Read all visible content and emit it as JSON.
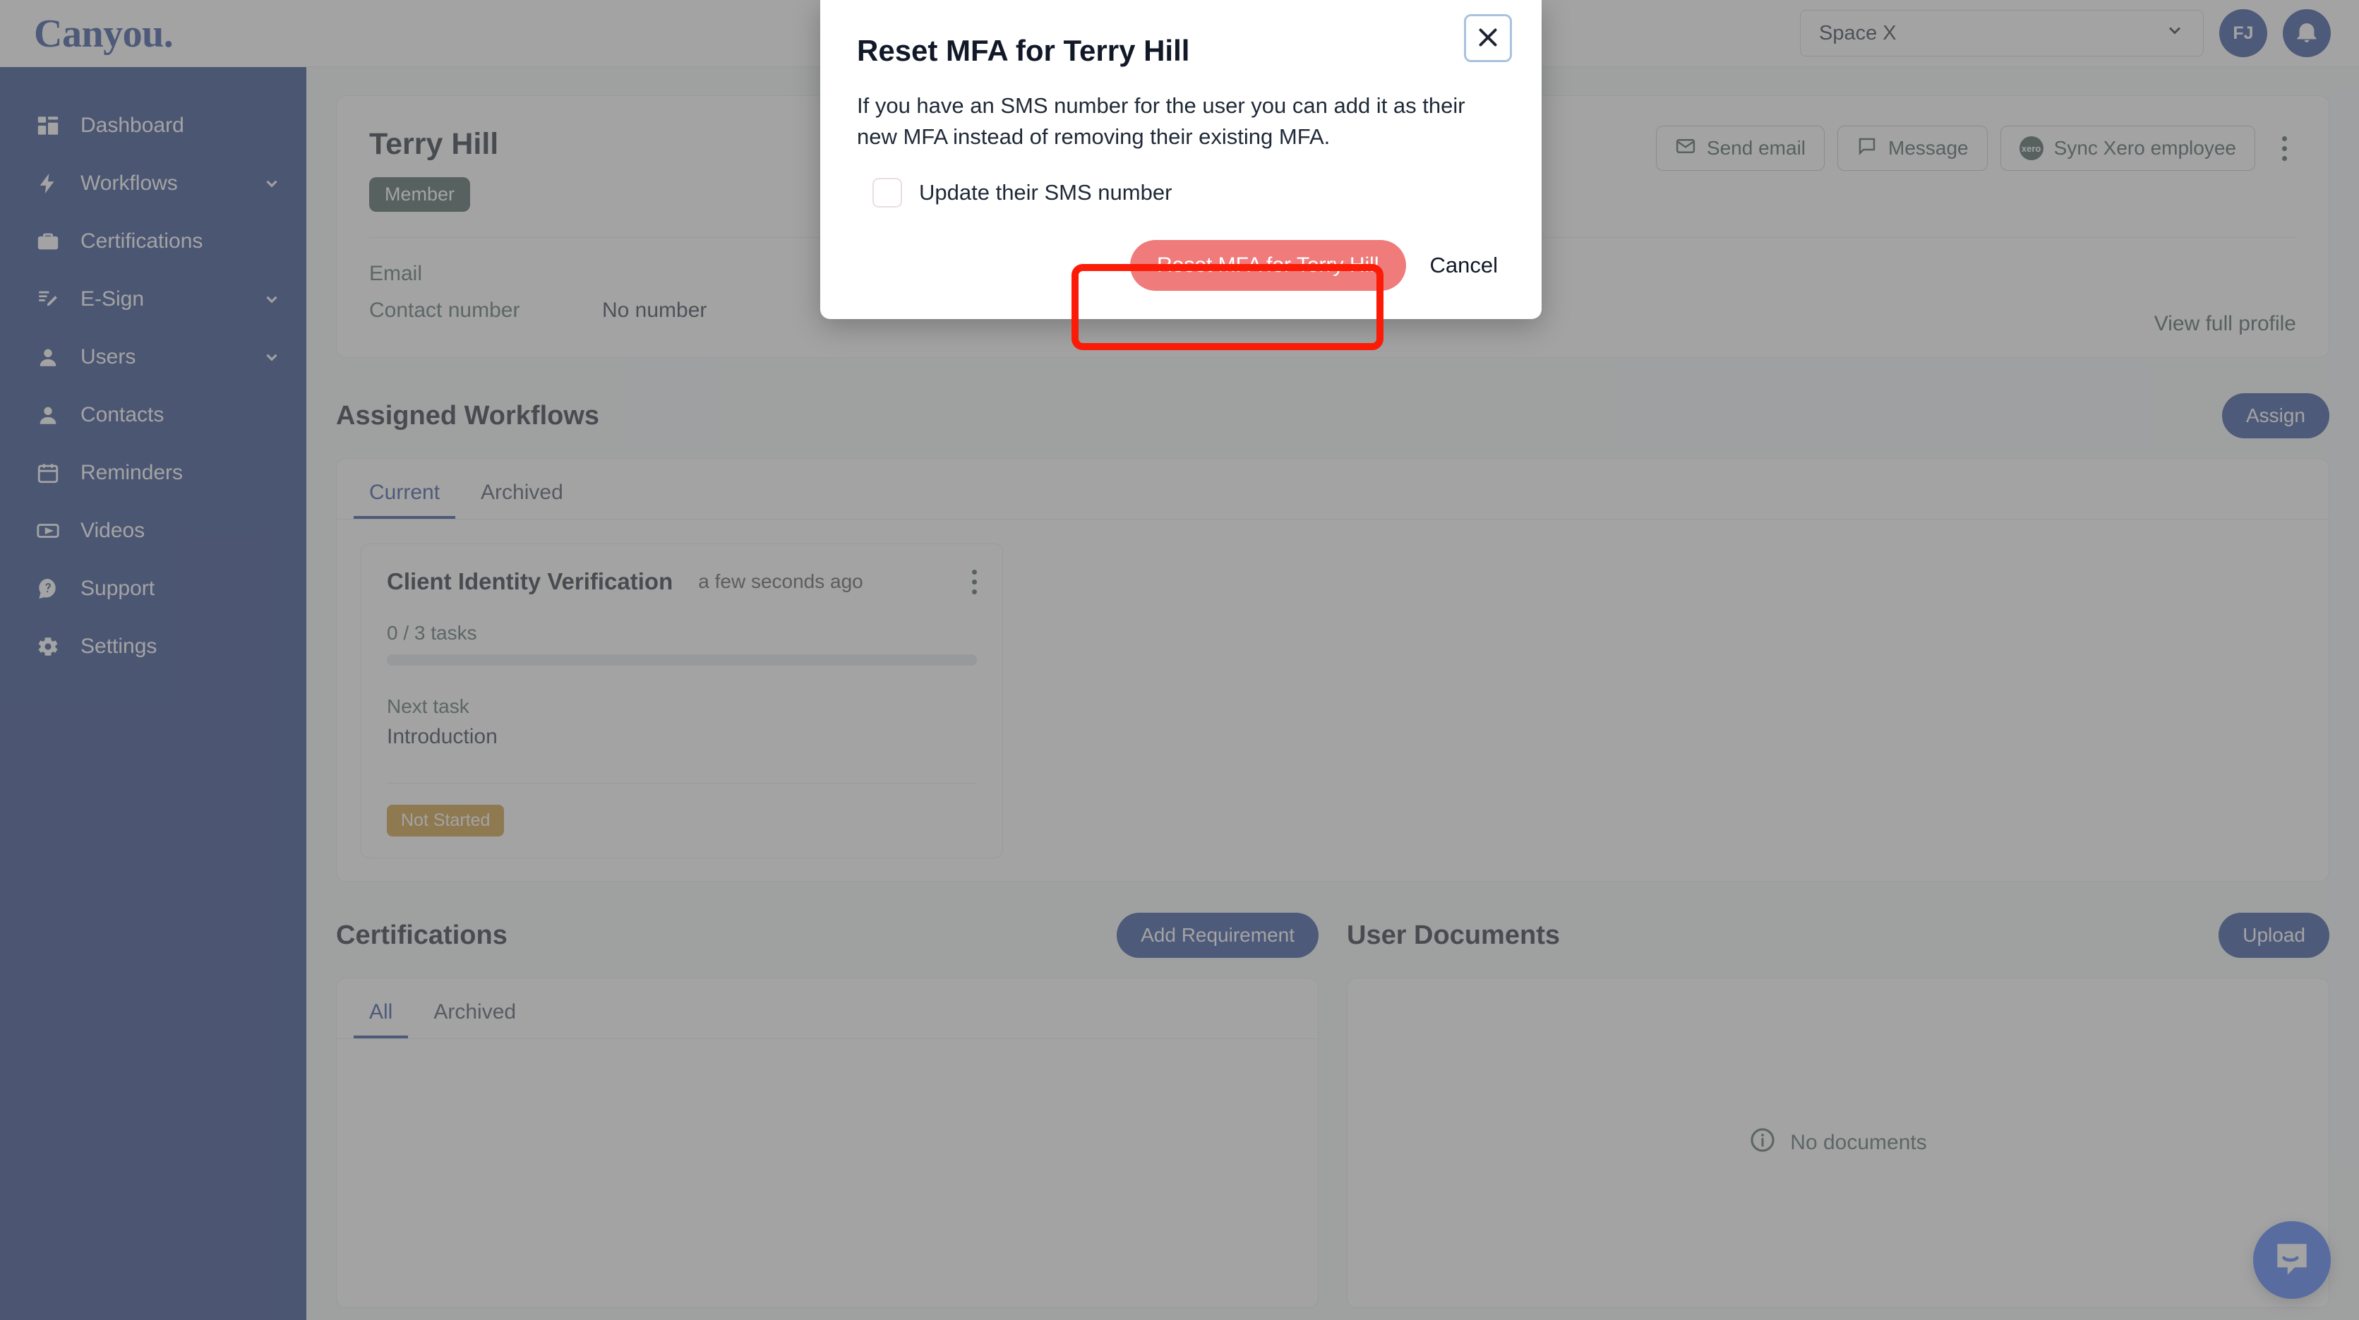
{
  "app": {
    "logo": "Canyou."
  },
  "sidebar": {
    "items": [
      {
        "label": "Dashboard",
        "icon": "dashboard-icon",
        "caret": false
      },
      {
        "label": "Workflows",
        "icon": "lightning-icon",
        "caret": true
      },
      {
        "label": "Certifications",
        "icon": "briefcase-icon",
        "caret": false
      },
      {
        "label": "E-Sign",
        "icon": "signature-icon",
        "caret": true
      },
      {
        "label": "Users",
        "icon": "user-icon",
        "caret": true
      },
      {
        "label": "Contacts",
        "icon": "user-icon",
        "caret": false
      },
      {
        "label": "Reminders",
        "icon": "calendar-icon",
        "caret": false
      },
      {
        "label": "Videos",
        "icon": "video-icon",
        "caret": false
      },
      {
        "label": "Support",
        "icon": "chat-question-icon",
        "caret": false
      },
      {
        "label": "Settings",
        "icon": "gear-icon",
        "caret": false
      }
    ]
  },
  "topbar": {
    "space_selected": "Space X",
    "avatar_initials": "FJ",
    "bell_icon": "bell-icon"
  },
  "profile": {
    "name": "Terry Hill",
    "role_badge": "Member",
    "fields": [
      {
        "label": "Email",
        "value": ""
      },
      {
        "label": "Contact number",
        "value": "No number"
      }
    ],
    "view_full_profile": "View full profile",
    "actions": [
      {
        "label": "Send email",
        "icon": "envelope-icon"
      },
      {
        "label": "Message",
        "icon": "message-icon"
      },
      {
        "label": "Sync Xero employee",
        "icon": "xero-icon"
      }
    ],
    "more_menu": "kebab-icon"
  },
  "workflows": {
    "title": "Assigned Workflows",
    "assign_label": "Assign",
    "tabs": [
      {
        "label": "Current",
        "active": true
      },
      {
        "label": "Archived",
        "active": false
      }
    ],
    "cards": [
      {
        "name": "Client Identity Verification",
        "time": "a few seconds ago",
        "tasks_text": "0 / 3 tasks",
        "progress_percent": 0,
        "next_task_label": "Next task",
        "next_task_value": "Introduction",
        "status": "Not Started"
      }
    ]
  },
  "certifications": {
    "title": "Certifications",
    "add_label": "Add Requirement",
    "tabs": [
      {
        "label": "All",
        "active": true
      },
      {
        "label": "Archived",
        "active": false
      }
    ]
  },
  "documents": {
    "title": "User Documents",
    "upload_label": "Upload",
    "empty_text": "No documents",
    "empty_icon": "info-icon"
  },
  "modal": {
    "title": "Reset MFA for Terry Hill",
    "body": "If you have an SMS number for the user you can add it as their new MFA instead of removing their existing MFA.",
    "checkbox_label": "Update their SMS number",
    "checkbox_checked": false,
    "confirm_label": "Reset MFA for Terry Hill",
    "cancel_label": "Cancel",
    "close_icon": "close-icon"
  },
  "chat": {
    "launcher_icon": "intercom-chat-icon"
  },
  "colors": {
    "sidebar": "#1a3580",
    "primary": "#1f3f91",
    "danger": "#ef7b7b",
    "status_amber": "#c79229",
    "badge_slate": "#37514f",
    "annotation": "#fc1b06",
    "intercom": "#3b6ef6"
  }
}
